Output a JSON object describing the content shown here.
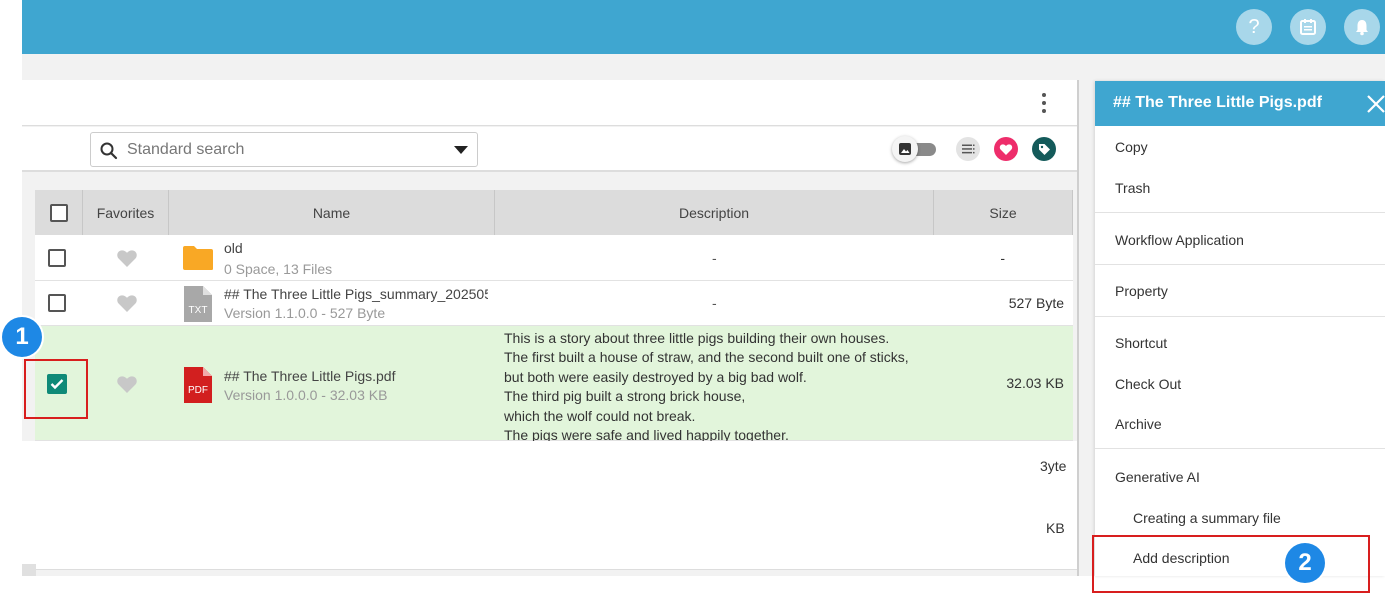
{
  "header": {
    "buttons": [
      {
        "icon": "help-icon",
        "glyph": "?"
      },
      {
        "icon": "calendar-icon"
      },
      {
        "icon": "bell-icon"
      }
    ],
    "color": "#3fa6d0"
  },
  "search": {
    "placeholder": "Standard search"
  },
  "table": {
    "headers": {
      "favorites": "Favorites",
      "name": "Name",
      "description": "Description",
      "size": "Size"
    },
    "rows": [
      {
        "type": "folder",
        "title": "old",
        "subtitle": "0 Space, 13 Files",
        "description": "-",
        "size": "-",
        "checked": false
      },
      {
        "type": "txt",
        "icon_label": "TXT",
        "title": "## The Three Little Pigs_summary_202505’",
        "subtitle": "Version 1.1.0.0 - 527 Byte",
        "description": "-",
        "size": "527 Byte",
        "checked": false
      },
      {
        "type": "pdf",
        "icon_label": "PDF",
        "title": "## The Three Little Pigs.pdf",
        "subtitle": "Version 1.0.0.0 - 32.03 KB",
        "description_lines": [
          "This is a story about three little pigs building their own houses.",
          "The first built a house of straw, and the second built one of sticks,",
          "but both were easily destroyed by a big bad wolf.",
          "The third pig built a strong brick house,",
          "which the wolf could not break.",
          "The pigs were safe and lived happily together."
        ],
        "size": "32.03 KB",
        "checked": true
      }
    ],
    "partial_sizes": [
      "3yte",
      "KB"
    ]
  },
  "context_menu": {
    "title": "## The Three Little Pigs.pdf",
    "items": {
      "copy": "Copy",
      "trash": "Trash",
      "workflow": "Workflow Application",
      "property": "Property",
      "shortcut": "Shortcut",
      "checkout": "Check Out",
      "archive": "Archive",
      "generative_ai": "Generative AI",
      "create_summary": "Creating a summary file",
      "add_description": "Add description"
    }
  },
  "annotations": {
    "step1": "1",
    "step2": "2",
    "badge_color": "#1e88e5",
    "highlight_color": "#d81e1e"
  }
}
